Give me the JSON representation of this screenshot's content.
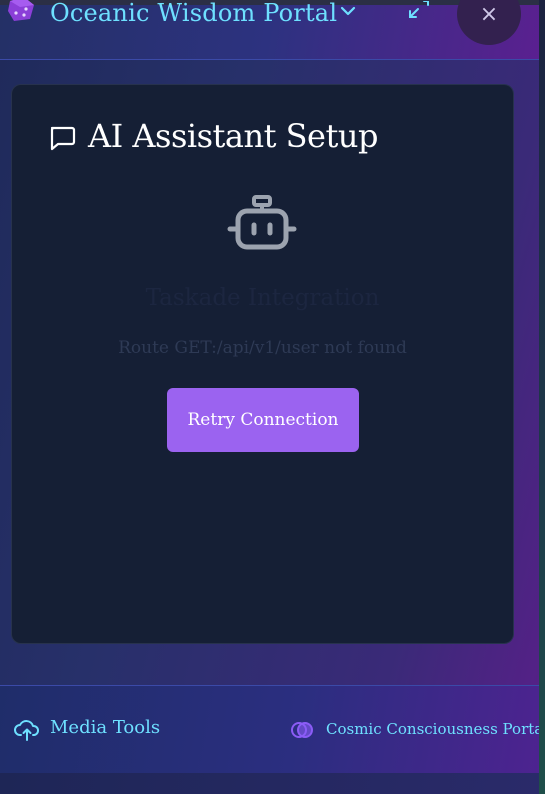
{
  "header": {
    "title": "Oceanic Wisdom Portal",
    "logo_icon": "dice-icon",
    "chevron_icon": "chevron-down-icon",
    "expand_icon": "expand-icon",
    "close_label": "×"
  },
  "card": {
    "title": "AI Assistant Setup",
    "title_icon": "chat-bubble-icon",
    "status_icon": "bot-icon",
    "integration_name": "Taskade Integration",
    "error_message": "Route GET:/api/v1/user not found",
    "retry_label": "Retry Connection"
  },
  "footer": {
    "media_tools_label": "Media Tools",
    "media_tools_icon": "cloud-upload-icon",
    "portal_label": "Cosmic Consciousness Portal",
    "portal_icon": "overlapping-circles-icon"
  },
  "colors": {
    "accent_cyan": "#6ee0ff",
    "button_purple": "#9b63f0",
    "card_bg": "#151f35"
  }
}
